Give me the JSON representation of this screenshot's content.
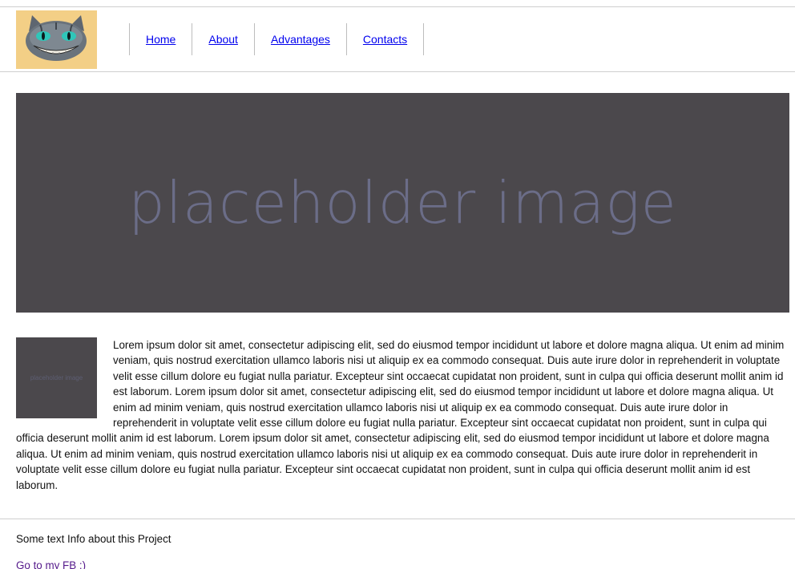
{
  "header": {
    "nav": [
      {
        "label": "Home"
      },
      {
        "label": "About"
      },
      {
        "label": "Advantages"
      },
      {
        "label": "Contacts"
      }
    ]
  },
  "hero": {
    "placeholder_text": "placeholder image"
  },
  "content": {
    "thumb_placeholder_text": "placeholder image",
    "paragraph": "Lorem ipsum dolor sit amet, consectetur adipiscing elit, sed do eiusmod tempor incididunt ut labore et dolore magna aliqua. Ut enim ad minim veniam, quis nostrud exercitation ullamco laboris nisi ut aliquip ex ea commodo consequat. Duis aute irure dolor in reprehenderit in voluptate velit esse cillum dolore eu fugiat nulla pariatur. Excepteur sint occaecat cupidatat non proident, sunt in culpa qui officia deserunt mollit anim id est laborum. Lorem ipsum dolor sit amet, consectetur adipiscing elit, sed do eiusmod tempor incididunt ut labore et dolore magna aliqua. Ut enim ad minim veniam, quis nostrud exercitation ullamco laboris nisi ut aliquip ex ea commodo consequat. Duis aute irure dolor in reprehenderit in voluptate velit esse cillum dolore eu fugiat nulla pariatur. Excepteur sint occaecat cupidatat non proident, sunt in culpa qui officia deserunt mollit anim id est laborum. Lorem ipsum dolor sit amet, consectetur adipiscing elit, sed do eiusmod tempor incididunt ut labore et dolore magna aliqua. Ut enim ad minim veniam, quis nostrud exercitation ullamco laboris nisi ut aliquip ex ea commodo consequat. Duis aute irure dolor in reprehenderit in voluptate velit esse cillum dolore eu fugiat nulla pariatur. Excepteur sint occaecat cupidatat non proident, sunt in culpa qui officia deserunt mollit anim id est laborum."
  },
  "footer": {
    "info": "Some text Info about this Project",
    "link": "Go to my FB :)"
  },
  "colors": {
    "hero_bg": "#4b484c",
    "link": "#0000ee",
    "visited_link": "#551a8b"
  },
  "icons": {
    "logo": "cheshire-cat-logo"
  }
}
